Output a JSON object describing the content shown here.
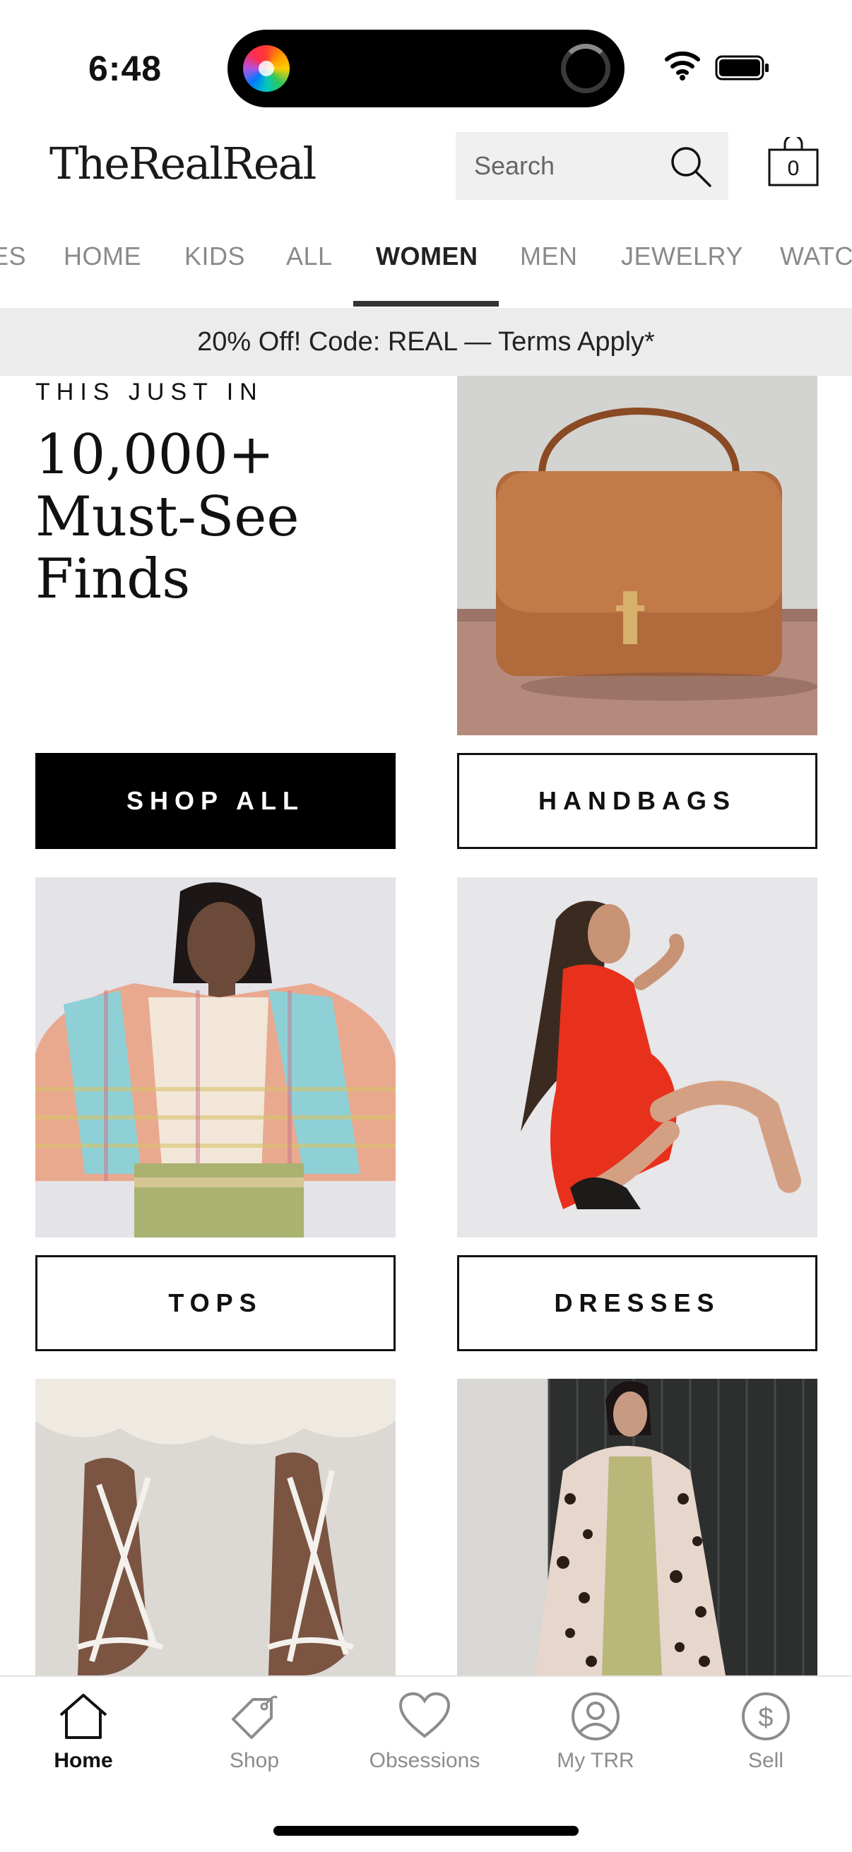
{
  "status_bar": {
    "time": "6:48"
  },
  "header": {
    "logo": "TheRealReal",
    "search_placeholder": "Search",
    "cart_count": "0"
  },
  "tabs": [
    {
      "label": "ES"
    },
    {
      "label": "HOME"
    },
    {
      "label": "KIDS"
    },
    {
      "label": "ALL"
    },
    {
      "label": "WOMEN",
      "active": true
    },
    {
      "label": "MEN"
    },
    {
      "label": "JEWELRY"
    },
    {
      "label": "WATCH"
    }
  ],
  "promo": {
    "text": "20% Off! Code: REAL — Terms Apply*"
  },
  "hero": {
    "eyebrow": "THIS JUST IN",
    "headline": "10,000+ Must-See Finds"
  },
  "ctas": {
    "shop_all": "SHOP ALL",
    "handbags": "HANDBAGS",
    "tops": "TOPS",
    "dresses": "DRESSES"
  },
  "bottom_nav": [
    {
      "label": "Home",
      "icon": "home-icon",
      "active": true
    },
    {
      "label": "Shop",
      "icon": "tag-icon"
    },
    {
      "label": "Obsessions",
      "icon": "heart-icon"
    },
    {
      "label": "My TRR",
      "icon": "profile-icon"
    },
    {
      "label": "Sell",
      "icon": "dollar-icon"
    }
  ],
  "colors": {
    "accent": "#000000",
    "promo_bg": "#ececec",
    "inactive_text": "#8a8a8a"
  }
}
